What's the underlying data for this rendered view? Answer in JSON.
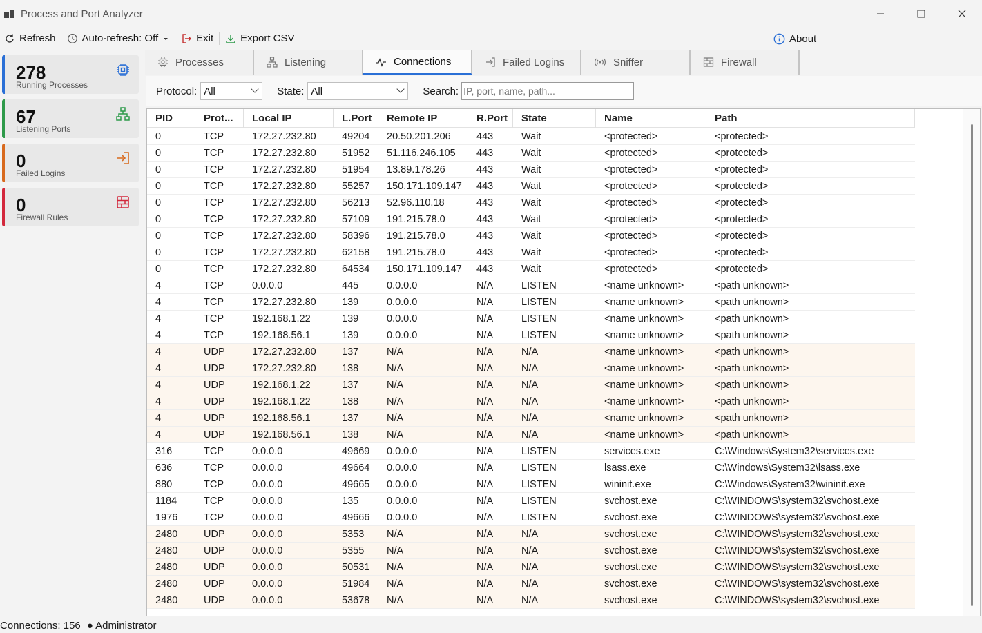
{
  "window": {
    "title": "Process and Port Analyzer"
  },
  "toolbar": {
    "refresh_label": "Refresh",
    "autorefresh_label": "Auto-refresh: Off",
    "exit_label": "Exit",
    "export_label": "Export CSV",
    "about_label": "About"
  },
  "stats": [
    {
      "value": "278",
      "label": "Running Processes",
      "icon": "cpu-icon",
      "color": "#2a6fd6"
    },
    {
      "value": "67",
      "label": "Listening Ports",
      "icon": "network-icon",
      "color": "#2e9a4a"
    },
    {
      "value": "0",
      "label": "Failed Logins",
      "icon": "login-icon",
      "color": "#d86a1e"
    },
    {
      "value": "0",
      "label": "Firewall Rules",
      "icon": "firewall-icon",
      "color": "#d3283c"
    }
  ],
  "tabs": [
    {
      "label": "Processes",
      "icon": "gear-icon"
    },
    {
      "label": "Listening",
      "icon": "network-icon"
    },
    {
      "label": "Connections",
      "icon": "activity-icon"
    },
    {
      "label": "Failed Logins",
      "icon": "login-icon"
    },
    {
      "label": "Sniffer",
      "icon": "radio-icon"
    },
    {
      "label": "Firewall",
      "icon": "firewall-icon"
    }
  ],
  "active_tab": "Connections",
  "filters": {
    "protocol_label": "Protocol:",
    "protocol_value": "All",
    "state_label": "State:",
    "state_value": "All",
    "search_label": "Search:",
    "search_placeholder": "IP, port, name, path..."
  },
  "table": {
    "columns": [
      "PID",
      "Prot...",
      "Local IP",
      "L.Port",
      "Remote IP",
      "R.Port",
      "State",
      "Name",
      "Path"
    ],
    "rows": [
      [
        "0",
        "TCP",
        "172.27.232.80",
        "49204",
        "20.50.201.206",
        "443",
        "Wait",
        "<protected>",
        "<protected>"
      ],
      [
        "0",
        "TCP",
        "172.27.232.80",
        "51952",
        "51.116.246.105",
        "443",
        "Wait",
        "<protected>",
        "<protected>"
      ],
      [
        "0",
        "TCP",
        "172.27.232.80",
        "51954",
        "13.89.178.26",
        "443",
        "Wait",
        "<protected>",
        "<protected>"
      ],
      [
        "0",
        "TCP",
        "172.27.232.80",
        "55257",
        "150.171.109.147",
        "443",
        "Wait",
        "<protected>",
        "<protected>"
      ],
      [
        "0",
        "TCP",
        "172.27.232.80",
        "56213",
        "52.96.110.18",
        "443",
        "Wait",
        "<protected>",
        "<protected>"
      ],
      [
        "0",
        "TCP",
        "172.27.232.80",
        "57109",
        "191.215.78.0",
        "443",
        "Wait",
        "<protected>",
        "<protected>"
      ],
      [
        "0",
        "TCP",
        "172.27.232.80",
        "58396",
        "191.215.78.0",
        "443",
        "Wait",
        "<protected>",
        "<protected>"
      ],
      [
        "0",
        "TCP",
        "172.27.232.80",
        "62158",
        "191.215.78.0",
        "443",
        "Wait",
        "<protected>",
        "<protected>"
      ],
      [
        "0",
        "TCP",
        "172.27.232.80",
        "64534",
        "150.171.109.147",
        "443",
        "Wait",
        "<protected>",
        "<protected>"
      ],
      [
        "4",
        "TCP",
        "0.0.0.0",
        "445",
        "0.0.0.0",
        "N/A",
        "LISTEN",
        "<name unknown>",
        "<path unknown>"
      ],
      [
        "4",
        "TCP",
        "172.27.232.80",
        "139",
        "0.0.0.0",
        "N/A",
        "LISTEN",
        "<name unknown>",
        "<path unknown>"
      ],
      [
        "4",
        "TCP",
        "192.168.1.22",
        "139",
        "0.0.0.0",
        "N/A",
        "LISTEN",
        "<name unknown>",
        "<path unknown>"
      ],
      [
        "4",
        "TCP",
        "192.168.56.1",
        "139",
        "0.0.0.0",
        "N/A",
        "LISTEN",
        "<name unknown>",
        "<path unknown>"
      ],
      [
        "4",
        "UDP",
        "172.27.232.80",
        "137",
        "N/A",
        "N/A",
        "N/A",
        "<name unknown>",
        "<path unknown>"
      ],
      [
        "4",
        "UDP",
        "172.27.232.80",
        "138",
        "N/A",
        "N/A",
        "N/A",
        "<name unknown>",
        "<path unknown>"
      ],
      [
        "4",
        "UDP",
        "192.168.1.22",
        "137",
        "N/A",
        "N/A",
        "N/A",
        "<name unknown>",
        "<path unknown>"
      ],
      [
        "4",
        "UDP",
        "192.168.1.22",
        "138",
        "N/A",
        "N/A",
        "N/A",
        "<name unknown>",
        "<path unknown>"
      ],
      [
        "4",
        "UDP",
        "192.168.56.1",
        "137",
        "N/A",
        "N/A",
        "N/A",
        "<name unknown>",
        "<path unknown>"
      ],
      [
        "4",
        "UDP",
        "192.168.56.1",
        "138",
        "N/A",
        "N/A",
        "N/A",
        "<name unknown>",
        "<path unknown>"
      ],
      [
        "316",
        "TCP",
        "0.0.0.0",
        "49669",
        "0.0.0.0",
        "N/A",
        "LISTEN",
        "services.exe",
        "C:\\Windows\\System32\\services.exe"
      ],
      [
        "636",
        "TCP",
        "0.0.0.0",
        "49664",
        "0.0.0.0",
        "N/A",
        "LISTEN",
        "lsass.exe",
        "C:\\Windows\\System32\\lsass.exe"
      ],
      [
        "880",
        "TCP",
        "0.0.0.0",
        "49665",
        "0.0.0.0",
        "N/A",
        "LISTEN",
        "wininit.exe",
        "C:\\Windows\\System32\\wininit.exe"
      ],
      [
        "1184",
        "TCP",
        "0.0.0.0",
        "135",
        "0.0.0.0",
        "N/A",
        "LISTEN",
        "svchost.exe",
        "C:\\WINDOWS\\system32\\svchost.exe"
      ],
      [
        "1976",
        "TCP",
        "0.0.0.0",
        "49666",
        "0.0.0.0",
        "N/A",
        "LISTEN",
        "svchost.exe",
        "C:\\WINDOWS\\system32\\svchost.exe"
      ],
      [
        "2480",
        "UDP",
        "0.0.0.0",
        "5353",
        "N/A",
        "N/A",
        "N/A",
        "svchost.exe",
        "C:\\WINDOWS\\system32\\svchost.exe"
      ],
      [
        "2480",
        "UDP",
        "0.0.0.0",
        "5355",
        "N/A",
        "N/A",
        "N/A",
        "svchost.exe",
        "C:\\WINDOWS\\system32\\svchost.exe"
      ],
      [
        "2480",
        "UDP",
        "0.0.0.0",
        "50531",
        "N/A",
        "N/A",
        "N/A",
        "svchost.exe",
        "C:\\WINDOWS\\system32\\svchost.exe"
      ],
      [
        "2480",
        "UDP",
        "0.0.0.0",
        "51984",
        "N/A",
        "N/A",
        "N/A",
        "svchost.exe",
        "C:\\WINDOWS\\system32\\svchost.exe"
      ],
      [
        "2480",
        "UDP",
        "0.0.0.0",
        "53678",
        "N/A",
        "N/A",
        "N/A",
        "svchost.exe",
        "C:\\WINDOWS\\system32\\svchost.exe"
      ]
    ]
  },
  "status": {
    "connections": "Connections: 156",
    "user": "● Administrator"
  }
}
